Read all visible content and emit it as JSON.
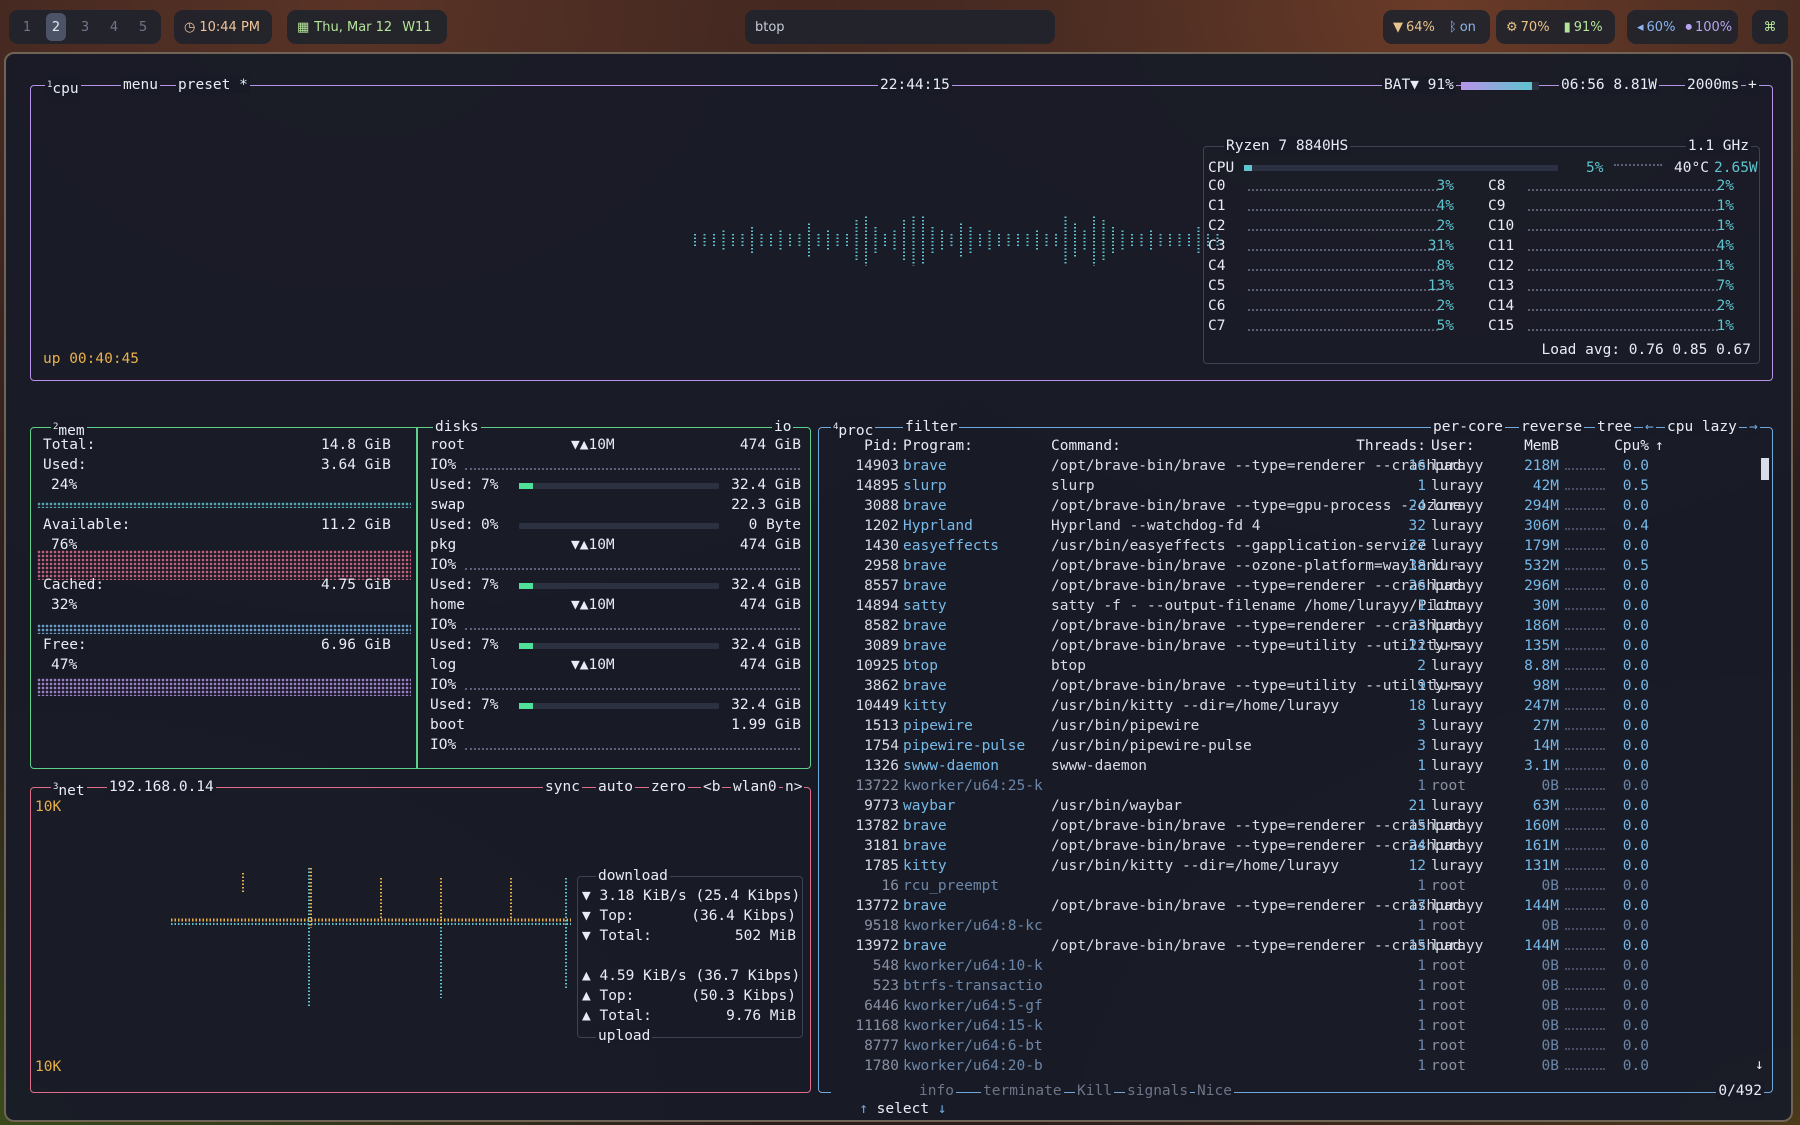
{
  "bar": {
    "workspaces": [
      "1",
      "2",
      "3",
      "4",
      "5"
    ],
    "active_workspace": "2",
    "time": "10:44 PM",
    "date": "Thu, Mar 12",
    "week": "W11",
    "window_title": "btop",
    "wifi": "64%",
    "bluetooth": "on",
    "cpu": "70%",
    "battery": "91%",
    "volume": "60%",
    "mic": "100%"
  },
  "cpu_box": {
    "num": "1",
    "title": "cpu",
    "menu": "menu",
    "preset": "preset *",
    "clock": "22:44:15",
    "bat_label": "BAT▼ 91%",
    "bat_fill": 0.91,
    "bat_time": "06:56 8.81W",
    "interval": "2000ms",
    "uptime": "up 00:40:45",
    "model": "Ryzen 7 8840HS",
    "freq": "1.1 GHz",
    "total_label": "CPU",
    "total_pct": "5%",
    "temp": "40°C",
    "watts": "2.65W",
    "cores_left": [
      {
        "name": "C0",
        "pct": "3%"
      },
      {
        "name": "C1",
        "pct": "4%"
      },
      {
        "name": "C2",
        "pct": "2%"
      },
      {
        "name": "C3",
        "pct": "31%"
      },
      {
        "name": "C4",
        "pct": "8%"
      },
      {
        "name": "C5",
        "pct": "13%"
      },
      {
        "name": "C6",
        "pct": "2%"
      },
      {
        "name": "C7",
        "pct": "5%"
      }
    ],
    "cores_right": [
      {
        "name": "C8",
        "pct": "2%"
      },
      {
        "name": "C9",
        "pct": "1%"
      },
      {
        "name": "C10",
        "pct": "1%"
      },
      {
        "name": "C11",
        "pct": "4%"
      },
      {
        "name": "C12",
        "pct": "1%"
      },
      {
        "name": "C13",
        "pct": "7%"
      },
      {
        "name": "C14",
        "pct": "2%"
      },
      {
        "name": "C15",
        "pct": "1%"
      }
    ],
    "load": "Load avg: 0.76 0.85 0.67"
  },
  "mem_box": {
    "num": "2",
    "title": "mem",
    "total_label": "Total:",
    "total": "14.8 GiB",
    "used_label": "Used:",
    "used": "3.64 GiB",
    "used_pct": "24%",
    "avail_label": "Available:",
    "avail": "11.2 GiB",
    "avail_pct": "76%",
    "cached_label": "Cached:",
    "cached": "4.75 GiB",
    "cached_pct": "32%",
    "free_label": "Free:",
    "free": "6.96 GiB",
    "free_pct": "47%"
  },
  "disks_box": {
    "title": "disks",
    "io": "io",
    "disks": [
      {
        "name": "root",
        "io": "▼▲10M",
        "size": "474 GiB",
        "used_pct": "7%",
        "used": "32.4 GiB",
        "fill": 0.07
      },
      {
        "name": "swap",
        "io": "",
        "size": "22.3 GiB",
        "used_pct": "0%",
        "used": "0 Byte",
        "fill": 0
      },
      {
        "name": "pkg",
        "io": "▼▲10M",
        "size": "474 GiB",
        "used_pct": "7%",
        "used": "32.4 GiB",
        "fill": 0.07
      },
      {
        "name": "home",
        "io": "▼▲10M",
        "size": "474 GiB",
        "used_pct": "7%",
        "used": "32.4 GiB",
        "fill": 0.07
      },
      {
        "name": "log",
        "io": "▼▲10M",
        "size": "474 GiB",
        "used_pct": "7%",
        "used": "32.4 GiB",
        "fill": 0.07
      },
      {
        "name": "boot",
        "io": "",
        "size": "1.99 GiB",
        "used_pct": "",
        "used": "",
        "fill": 0
      }
    ],
    "io_label": "IO%",
    "used_label": "Used:"
  },
  "net_box": {
    "num": "3",
    "title": "net",
    "ip": "192.168.0.14",
    "sync": "sync",
    "auto": "auto",
    "zero": "zero",
    "prev": "<b",
    "iface": "wlan0",
    "next": "n>",
    "scale_top": "10K",
    "scale_bottom": "10K",
    "download_title": "download",
    "upload_title": "upload",
    "dl_rate": "▼ 3.18 KiB/s (25.4 Kibps)",
    "dl_top_label": "▼ Top:",
    "dl_top": "(36.4 Kibps)",
    "dl_total_label": "▼ Total:",
    "dl_total": "502 MiB",
    "ul_rate": "▲ 4.59 KiB/s (36.7 Kibps)",
    "ul_top_label": "▲ Top:",
    "ul_top": "(50.3 Kibps)",
    "ul_total_label": "▲ Total:",
    "ul_total": "9.76 MiB"
  },
  "proc_box": {
    "num": "4",
    "title": "proc",
    "filter": "filter",
    "per_core": "per-core",
    "reverse": "reverse",
    "tree": "tree",
    "sort": "cpu lazy",
    "headers": {
      "pid": "Pid:",
      "program": "Program:",
      "command": "Command:",
      "threads": "Threads:",
      "user": "User:",
      "mem": "MemB",
      "cpu": "Cpu%"
    },
    "rows": [
      {
        "pid": "14903",
        "program": "brave",
        "command": "/opt/brave-bin/brave --type=renderer --crashpad",
        "threads": "16",
        "user": "lurayy",
        "mem": "218M",
        "cpu": "0.0"
      },
      {
        "pid": "14895",
        "program": "slurp",
        "command": "slurp",
        "threads": "1",
        "user": "lurayy",
        "mem": "42M",
        "cpu": "0.5"
      },
      {
        "pid": "3088",
        "program": "brave",
        "command": "/opt/brave-bin/brave --type=gpu-process --ozone",
        "threads": "24",
        "user": "lurayy",
        "mem": "294M",
        "cpu": "0.0"
      },
      {
        "pid": "1202",
        "program": "Hyprland",
        "command": "Hyprland --watchdog-fd 4",
        "threads": "32",
        "user": "lurayy",
        "mem": "306M",
        "cpu": "0.4"
      },
      {
        "pid": "1430",
        "program": "easyeffects",
        "command": "/usr/bin/easyeffects --gapplication-service",
        "threads": "27",
        "user": "lurayy",
        "mem": "179M",
        "cpu": "0.0"
      },
      {
        "pid": "2958",
        "program": "brave",
        "command": "/opt/brave-bin/brave --ozone-platform=wayland -",
        "threads": "38",
        "user": "lurayy",
        "mem": "532M",
        "cpu": "0.5"
      },
      {
        "pid": "8557",
        "program": "brave",
        "command": "/opt/brave-bin/brave --type=renderer --crashpad",
        "threads": "26",
        "user": "lurayy",
        "mem": "296M",
        "cpu": "0.0"
      },
      {
        "pid": "14894",
        "program": "satty",
        "command": "satty -f - --output-filename /home/lurayy/Pictu",
        "threads": "1",
        "user": "lurayy",
        "mem": "30M",
        "cpu": "0.0"
      },
      {
        "pid": "8582",
        "program": "brave",
        "command": "/opt/brave-bin/brave --type=renderer --crashpad",
        "threads": "23",
        "user": "lurayy",
        "mem": "186M",
        "cpu": "0.0"
      },
      {
        "pid": "3089",
        "program": "brave",
        "command": "/opt/brave-bin/brave --type=utility --utility-s",
        "threads": "22",
        "user": "lurayy",
        "mem": "135M",
        "cpu": "0.0"
      },
      {
        "pid": "10925",
        "program": "btop",
        "command": "btop",
        "threads": "2",
        "user": "lurayy",
        "mem": "8.8M",
        "cpu": "0.0"
      },
      {
        "pid": "3862",
        "program": "brave",
        "command": "/opt/brave-bin/brave --type=utility --utility-s",
        "threads": "9",
        "user": "lurayy",
        "mem": "98M",
        "cpu": "0.0"
      },
      {
        "pid": "10449",
        "program": "kitty",
        "command": "/usr/bin/kitty --dir=/home/lurayy",
        "threads": "18",
        "user": "lurayy",
        "mem": "247M",
        "cpu": "0.0"
      },
      {
        "pid": "1513",
        "program": "pipewire",
        "command": "/usr/bin/pipewire",
        "threads": "3",
        "user": "lurayy",
        "mem": "27M",
        "cpu": "0.0"
      },
      {
        "pid": "1754",
        "program": "pipewire-pulse",
        "command": "/usr/bin/pipewire-pulse",
        "threads": "3",
        "user": "lurayy",
        "mem": "14M",
        "cpu": "0.0"
      },
      {
        "pid": "1326",
        "program": "swww-daemon",
        "command": "swww-daemon",
        "threads": "1",
        "user": "lurayy",
        "mem": "3.1M",
        "cpu": "0.0"
      },
      {
        "pid": "13722",
        "program": "kworker/u64:25-k",
        "command": "",
        "threads": "1",
        "user": "root",
        "mem": "0B",
        "cpu": "0.0",
        "kernel": true
      },
      {
        "pid": "9773",
        "program": "waybar",
        "command": "/usr/bin/waybar",
        "threads": "21",
        "user": "lurayy",
        "mem": "63M",
        "cpu": "0.0"
      },
      {
        "pid": "13782",
        "program": "brave",
        "command": "/opt/brave-bin/brave --type=renderer --crashpad",
        "threads": "15",
        "user": "lurayy",
        "mem": "160M",
        "cpu": "0.0"
      },
      {
        "pid": "3181",
        "program": "brave",
        "command": "/opt/brave-bin/brave --type=renderer --crashpad",
        "threads": "24",
        "user": "lurayy",
        "mem": "161M",
        "cpu": "0.0"
      },
      {
        "pid": "1785",
        "program": "kitty",
        "command": "/usr/bin/kitty --dir=/home/lurayy",
        "threads": "12",
        "user": "lurayy",
        "mem": "131M",
        "cpu": "0.0"
      },
      {
        "pid": "16",
        "program": "rcu_preempt",
        "command": "",
        "threads": "1",
        "user": "root",
        "mem": "0B",
        "cpu": "0.0",
        "kernel": true
      },
      {
        "pid": "13772",
        "program": "brave",
        "command": "/opt/brave-bin/brave --type=renderer --crashpad",
        "threads": "17",
        "user": "lurayy",
        "mem": "144M",
        "cpu": "0.0"
      },
      {
        "pid": "9518",
        "program": "kworker/u64:8-kc",
        "command": "",
        "threads": "1",
        "user": "root",
        "mem": "0B",
        "cpu": "0.0",
        "kernel": true
      },
      {
        "pid": "13972",
        "program": "brave",
        "command": "/opt/brave-bin/brave --type=renderer --crashpad",
        "threads": "15",
        "user": "lurayy",
        "mem": "144M",
        "cpu": "0.0"
      },
      {
        "pid": "548",
        "program": "kworker/u64:10-k",
        "command": "",
        "threads": "1",
        "user": "root",
        "mem": "0B",
        "cpu": "0.0",
        "kernel": true
      },
      {
        "pid": "523",
        "program": "btrfs-transactio",
        "command": "",
        "threads": "1",
        "user": "root",
        "mem": "0B",
        "cpu": "0.0",
        "kernel": true
      },
      {
        "pid": "6446",
        "program": "kworker/u64:5-gf",
        "command": "",
        "threads": "1",
        "user": "root",
        "mem": "0B",
        "cpu": "0.0",
        "kernel": true
      },
      {
        "pid": "11168",
        "program": "kworker/u64:15-k",
        "command": "",
        "threads": "1",
        "user": "root",
        "mem": "0B",
        "cpu": "0.0",
        "kernel": true
      },
      {
        "pid": "8777",
        "program": "kworker/u64:6-bt",
        "command": "",
        "threads": "1",
        "user": "root",
        "mem": "0B",
        "cpu": "0.0",
        "kernel": true
      },
      {
        "pid": "1780",
        "program": "kworker/u64:20-b",
        "command": "",
        "threads": "1",
        "user": "root",
        "mem": "0B",
        "cpu": "0.0",
        "kernel": true
      }
    ],
    "footer": {
      "select": "select",
      "info": "info",
      "terminate": "terminate",
      "kill": "Kill",
      "signals": "signals",
      "nice": "Nice",
      "count": "0/492"
    }
  },
  "colors": {
    "cpu_border": "#b794e8",
    "mem_border": "#5fd08a",
    "net_border": "#e06c88",
    "proc_border": "#6fa8dc",
    "accent_cyan": "#5ec4ce",
    "gold": "#e8b04c"
  }
}
